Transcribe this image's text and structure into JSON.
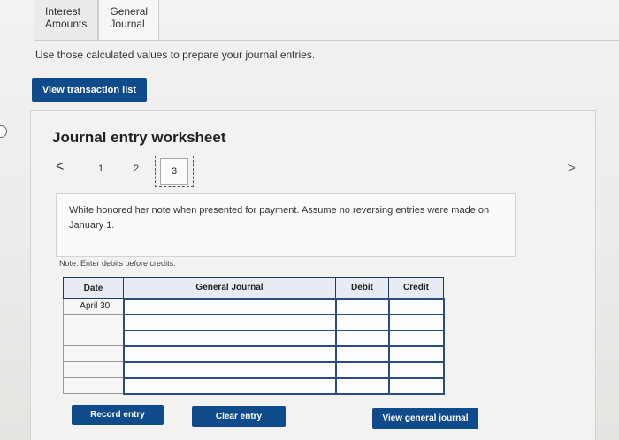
{
  "tabs": [
    {
      "label": "Interest\nAmounts"
    },
    {
      "label": "General\nJournal"
    }
  ],
  "instructions": "Use those calculated values to prepare your journal entries.",
  "view_transaction_list": "View transaction list",
  "worksheet": {
    "title": "Journal entry worksheet",
    "pager": {
      "prev": "<",
      "pages": [
        "1",
        "2",
        "3"
      ],
      "current": "3",
      "next": ">"
    },
    "description": "White honored her note when presented for payment. Assume no reversing entries were made on January 1.",
    "note": "Note: Enter debits before credits.",
    "table": {
      "headers": {
        "date": "Date",
        "account": "General Journal",
        "debit": "Debit",
        "credit": "Credit"
      },
      "rows": [
        {
          "date": "April 30",
          "account": "",
          "debit": "",
          "credit": ""
        },
        {
          "date": "",
          "account": "",
          "debit": "",
          "credit": ""
        },
        {
          "date": "",
          "account": "",
          "debit": "",
          "credit": ""
        },
        {
          "date": "",
          "account": "",
          "debit": "",
          "credit": ""
        },
        {
          "date": "",
          "account": "",
          "debit": "",
          "credit": ""
        },
        {
          "date": "",
          "account": "",
          "debit": "",
          "credit": ""
        }
      ]
    },
    "buttons": {
      "record": "Record entry",
      "clear": "Clear entry",
      "view_journal": "View general journal"
    }
  },
  "colors": {
    "button_blue": "#0f4a8a",
    "table_border": "#1c3a5e"
  }
}
